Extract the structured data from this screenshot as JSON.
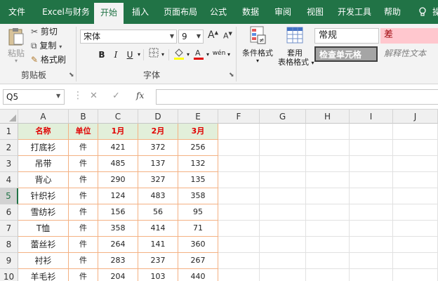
{
  "tabs": [
    "文件",
    "Excel与财务",
    "开始",
    "插入",
    "页面布局",
    "公式",
    "数据",
    "审阅",
    "视图",
    "开发工具",
    "帮助",
    "操"
  ],
  "active_tab": "开始",
  "clipboard": {
    "paste": "粘贴",
    "cut": "剪切",
    "copy": "复制",
    "painter": "格式刷",
    "group": "剪贴板"
  },
  "font": {
    "name": "宋体",
    "size": "9",
    "group": "字体",
    "bold": "B",
    "italic": "I",
    "underline": "U",
    "grow": "A",
    "shrink": "A",
    "phonetic": "wén"
  },
  "styles": {
    "conditional": "条件格式",
    "table_format": "套用",
    "table_format2": "表格格式",
    "normal": "常规",
    "bad": "差",
    "check_cell": "检查单元格",
    "explanatory": "解释性文本"
  },
  "formula_bar": {
    "name_box": "Q5",
    "cancel": "✕",
    "enter": "✓",
    "fx": "fx"
  },
  "columns": [
    "A",
    "B",
    "C",
    "D",
    "E",
    "F",
    "G",
    "H",
    "I",
    "J"
  ],
  "rows": [
    "1",
    "2",
    "3",
    "4",
    "5",
    "6",
    "7",
    "8",
    "9",
    "10"
  ],
  "selected_row": "5",
  "table": {
    "headers": [
      "名称",
      "单位",
      "1月",
      "2月",
      "3月"
    ],
    "body": [
      [
        "打底衫",
        "件",
        "421",
        "372",
        "256"
      ],
      [
        "吊带",
        "件",
        "485",
        "137",
        "132"
      ],
      [
        "背心",
        "件",
        "290",
        "327",
        "135"
      ],
      [
        "针织衫",
        "件",
        "124",
        "483",
        "358"
      ],
      [
        "雪纺衫",
        "件",
        "156",
        "56",
        "95"
      ],
      [
        "T恤",
        "件",
        "358",
        "414",
        "71"
      ],
      [
        "蕾丝衫",
        "件",
        "264",
        "141",
        "360"
      ],
      [
        "衬衫",
        "件",
        "283",
        "237",
        "267"
      ],
      [
        "羊毛衫",
        "件",
        "204",
        "103",
        "440"
      ]
    ]
  },
  "colors": {
    "ribbon": "#217346",
    "header_fill": "#e2efda",
    "header_text": "#e00000",
    "table_border": "#f4b183",
    "bad_fill": "#ffc7ce",
    "bad_text": "#9c0006",
    "check_fill": "#a5a5a5"
  }
}
